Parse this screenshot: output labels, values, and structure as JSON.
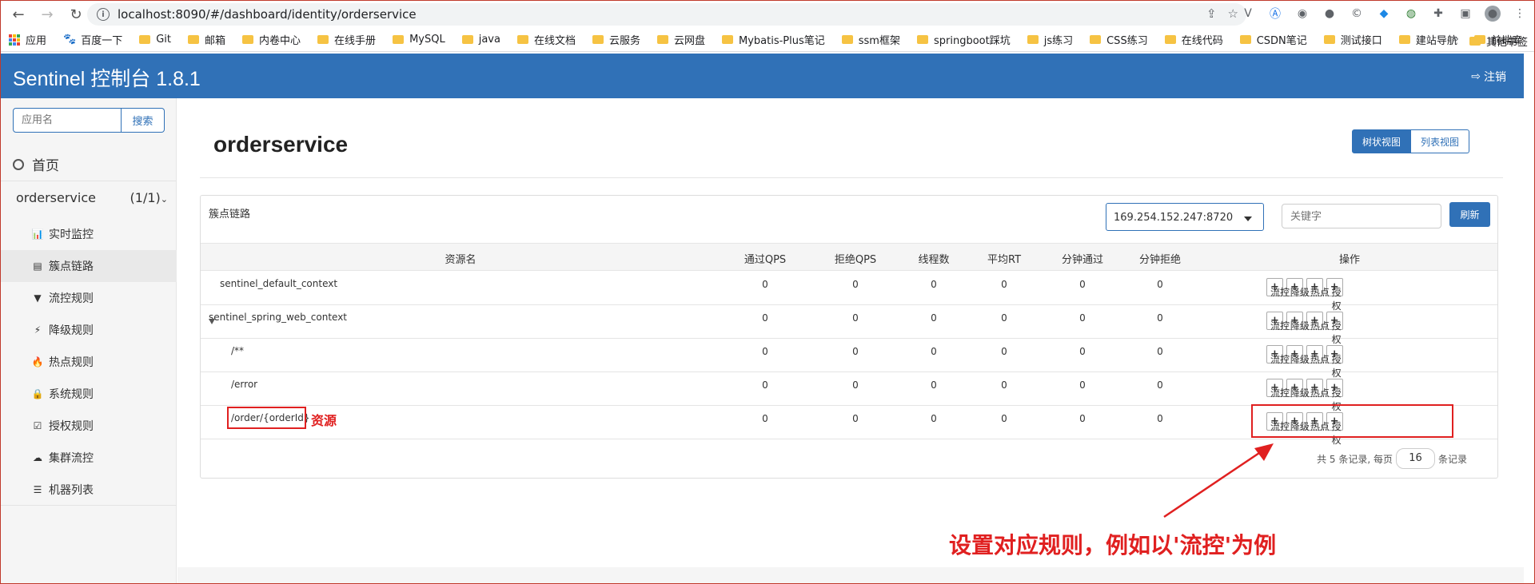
{
  "browser": {
    "url": "localhost:8090/#/dashboard/identity/orderservice",
    "bookmarks": [
      "应用",
      "百度一下",
      "Git",
      "邮箱",
      "内卷中心",
      "在线手册",
      "MySQL",
      "java",
      "在线文档",
      "云服务",
      "云网盘",
      "Mybatis-Plus笔记",
      "ssm框架",
      "springboot踩坑",
      "js练习",
      "CSS练习",
      "在线代码",
      "CSDN笔记",
      "测试接口",
      "建站导航",
      "前端库"
    ],
    "other_bookmarks": "其他书签"
  },
  "header": {
    "brand": "Sentinel 控制台 1.8.1",
    "logout": "注销"
  },
  "sidebar": {
    "search_placeholder": "应用名",
    "search_button": "搜索",
    "home": "首页",
    "app_name": "orderservice",
    "app_count": "(1/1)",
    "menu": [
      {
        "label": "实时监控",
        "icon": "bar-chart-icon",
        "glyph": "📊"
      },
      {
        "label": "簇点链路",
        "icon": "list-icon",
        "glyph": "▤"
      },
      {
        "label": "流控规则",
        "icon": "filter-icon",
        "glyph": "▼"
      },
      {
        "label": "降级规则",
        "icon": "flash-icon",
        "glyph": "⚡"
      },
      {
        "label": "热点规则",
        "icon": "fire-icon",
        "glyph": "🔥"
      },
      {
        "label": "系统规则",
        "icon": "lock-icon",
        "glyph": "🔒"
      },
      {
        "label": "授权规则",
        "icon": "check-square-icon",
        "glyph": "☑"
      },
      {
        "label": "集群流控",
        "icon": "cloud-icon",
        "glyph": "☁"
      },
      {
        "label": "机器列表",
        "icon": "th-list-icon",
        "glyph": "☰"
      }
    ]
  },
  "main": {
    "title": "orderservice",
    "view_tree": "树状视图",
    "view_list": "列表视图",
    "panel_title": "簇点链路",
    "machine": "169.254.152.247:8720",
    "keyword_placeholder": "关键字",
    "refresh": "刷新",
    "columns": [
      "资源名",
      "通过QPS",
      "拒绝QPS",
      "线程数",
      "平均RT",
      "分钟通过",
      "分钟拒绝",
      "操作"
    ],
    "rows": [
      {
        "name": "sentinel_default_context",
        "pass_qps": "0",
        "block_qps": "0",
        "threads": "0",
        "avg_rt": "0",
        "min_pass": "0",
        "min_block": "0"
      },
      {
        "name": "sentinel_spring_web_context",
        "pass_qps": "0",
        "block_qps": "0",
        "threads": "0",
        "avg_rt": "0",
        "min_pass": "0",
        "min_block": "0"
      },
      {
        "name": "/**",
        "pass_qps": "0",
        "block_qps": "0",
        "threads": "0",
        "avg_rt": "0",
        "min_pass": "0",
        "min_block": "0"
      },
      {
        "name": "/error",
        "pass_qps": "0",
        "block_qps": "0",
        "threads": "0",
        "avg_rt": "0",
        "min_pass": "0",
        "min_block": "0"
      },
      {
        "name": "/order/{orderId}",
        "pass_qps": "0",
        "block_qps": "0",
        "threads": "0",
        "avg_rt": "0",
        "min_pass": "0",
        "min_block": "0"
      }
    ],
    "actions": [
      "流控",
      "降级",
      "热点",
      "授权"
    ],
    "pager_prefix": "共 5 条记录, 每页",
    "page_size": "16",
    "pager_suffix": "条记录"
  },
  "annotations": {
    "resource": "资源",
    "instruction": "设置对应规则，例如以'流控'为例"
  },
  "colors": {
    "header": "#3071b7",
    "annotation": "#e02020"
  }
}
